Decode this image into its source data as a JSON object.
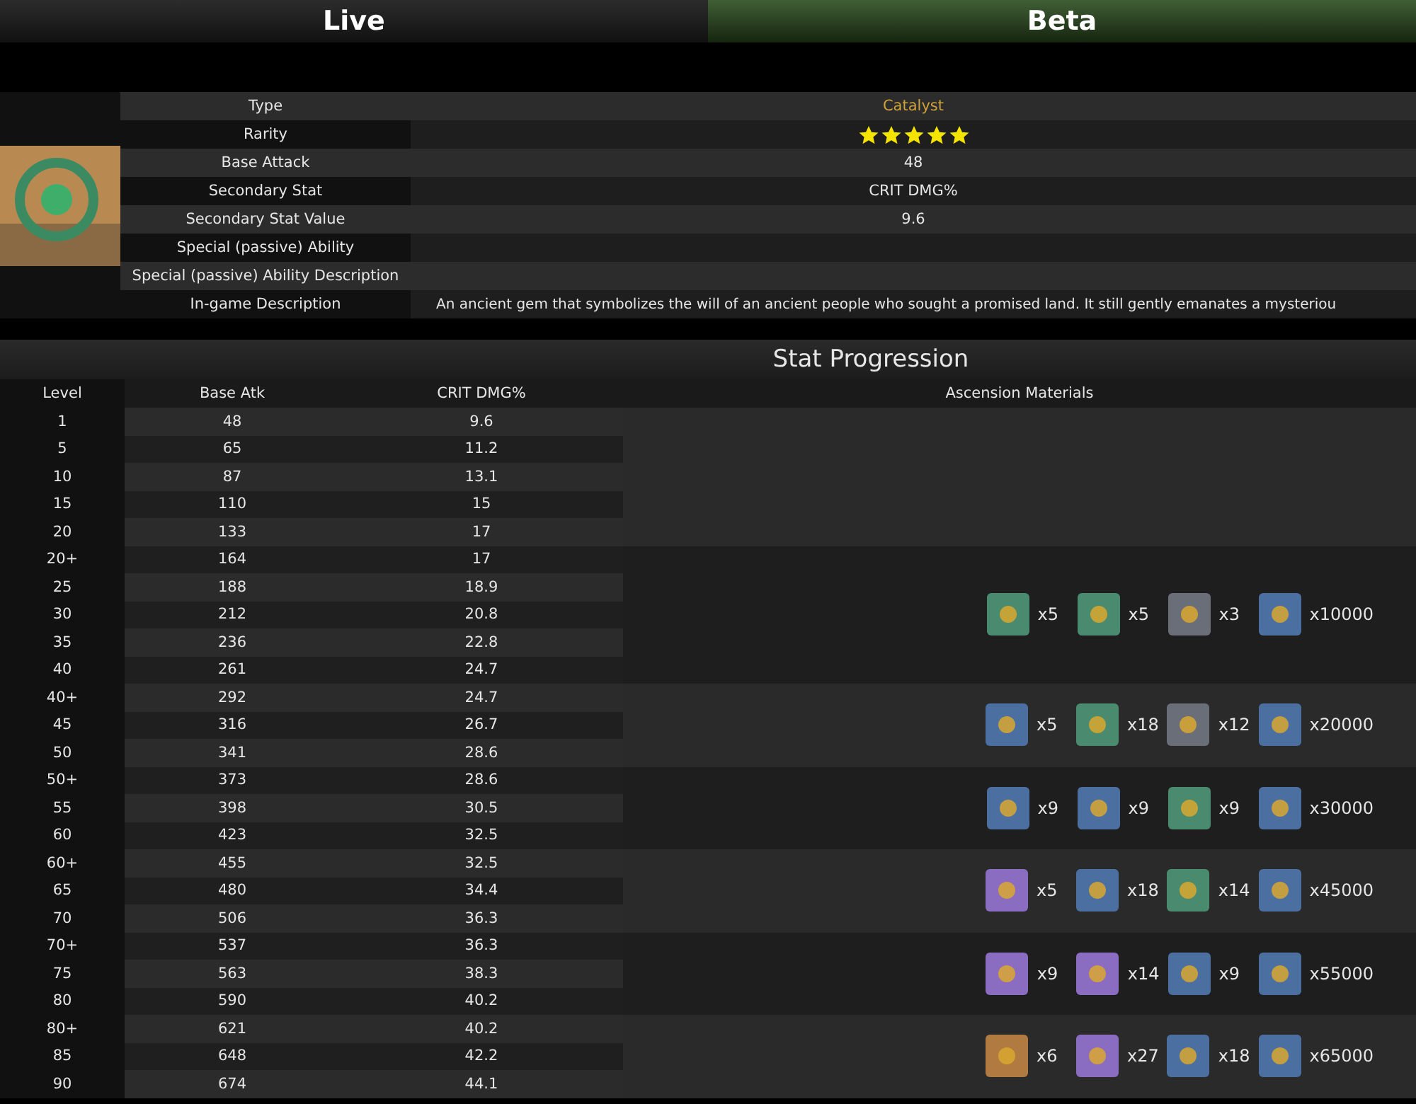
{
  "tabs": [
    {
      "label": "Live",
      "selected": false
    },
    {
      "label": "Beta",
      "selected": true
    }
  ],
  "info": {
    "rows": [
      {
        "label": "Type",
        "value": "Catalyst",
        "kind": "type"
      },
      {
        "label": "Rarity",
        "stars": 5,
        "kind": "stars"
      },
      {
        "label": "Base Attack",
        "value": "48",
        "kind": "text"
      },
      {
        "label": "Secondary Stat",
        "value": "CRIT DMG%",
        "kind": "text"
      },
      {
        "label": "Secondary Stat Value",
        "value": "9.6",
        "kind": "text"
      },
      {
        "label": "Special (passive) Ability",
        "kind": "text"
      },
      {
        "label": "Special (passive) Ability Description",
        "kind": "text"
      },
      {
        "label": "In-game Description",
        "value": "An ancient gem that symbolizes the will of an ancient people who sought a promised land. It still gently emanates a mysteriou",
        "kind": "description"
      }
    ]
  },
  "progression": {
    "title": "Stat Progression",
    "columns": [
      "Level",
      "Base Atk",
      "CRIT DMG%",
      "Ascension Materials"
    ],
    "groups": [
      {
        "rows": [
          [
            "1",
            "48",
            "9.6"
          ],
          [
            "5",
            "65",
            "11.2"
          ],
          [
            "10",
            "87",
            "13.1"
          ],
          [
            "15",
            "110",
            "15"
          ],
          [
            "20",
            "133",
            "17"
          ]
        ]
      },
      {
        "materials": [
          {
            "count": "x5",
            "color": "#4a8a6e"
          },
          {
            "count": "x5",
            "color": "#4a8a6e"
          },
          {
            "count": "x3",
            "color": "#6a6e78"
          },
          {
            "count": "x10000",
            "color": "#4a6fa0"
          }
        ],
        "rows": [
          [
            "20+",
            "164",
            "17"
          ],
          [
            "25",
            "188",
            "18.9"
          ],
          [
            "30",
            "212",
            "20.8"
          ],
          [
            "35",
            "236",
            "22.8"
          ],
          [
            "40",
            "261",
            "24.7"
          ]
        ]
      },
      {
        "materials": [
          {
            "count": "x5",
            "color": "#4a6fa0"
          },
          {
            "count": "x18",
            "color": "#4a8a6e"
          },
          {
            "count": "x12",
            "color": "#6a6e78"
          },
          {
            "count": "x20000",
            "color": "#4a6fa0"
          }
        ],
        "rows": [
          [
            "40+",
            "292",
            "24.7"
          ],
          [
            "45",
            "316",
            "26.7"
          ],
          [
            "50",
            "341",
            "28.6"
          ]
        ]
      },
      {
        "materials": [
          {
            "count": "x9",
            "color": "#4a6fa0"
          },
          {
            "count": "x9",
            "color": "#4a6fa0"
          },
          {
            "count": "x9",
            "color": "#4a8a6e"
          },
          {
            "count": "x30000",
            "color": "#4a6fa0"
          }
        ],
        "rows": [
          [
            "50+",
            "373",
            "28.6"
          ],
          [
            "55",
            "398",
            "30.5"
          ],
          [
            "60",
            "423",
            "32.5"
          ]
        ]
      },
      {
        "materials": [
          {
            "count": "x5",
            "color": "#8a6cc0"
          },
          {
            "count": "x18",
            "color": "#4a6fa0"
          },
          {
            "count": "x14",
            "color": "#4a8a6e"
          },
          {
            "count": "x45000",
            "color": "#4a6fa0"
          }
        ],
        "rows": [
          [
            "60+",
            "455",
            "32.5"
          ],
          [
            "65",
            "480",
            "34.4"
          ],
          [
            "70",
            "506",
            "36.3"
          ]
        ]
      },
      {
        "materials": [
          {
            "count": "x9",
            "color": "#8a6cc0"
          },
          {
            "count": "x14",
            "color": "#8a6cc0"
          },
          {
            "count": "x9",
            "color": "#4a6fa0"
          },
          {
            "count": "x55000",
            "color": "#4a6fa0"
          }
        ],
        "rows": [
          [
            "70+",
            "537",
            "36.3"
          ],
          [
            "75",
            "563",
            "38.3"
          ],
          [
            "80",
            "590",
            "40.2"
          ]
        ]
      },
      {
        "materials": [
          {
            "count": "x6",
            "color": "#b07a40"
          },
          {
            "count": "x27",
            "color": "#8a6cc0"
          },
          {
            "count": "x18",
            "color": "#4a6fa0"
          },
          {
            "count": "x65000",
            "color": "#4a6fa0"
          }
        ],
        "rows": [
          [
            "80+",
            "621",
            "40.2"
          ],
          [
            "85",
            "648",
            "42.2"
          ],
          [
            "90",
            "674",
            "44.1"
          ]
        ]
      }
    ]
  }
}
